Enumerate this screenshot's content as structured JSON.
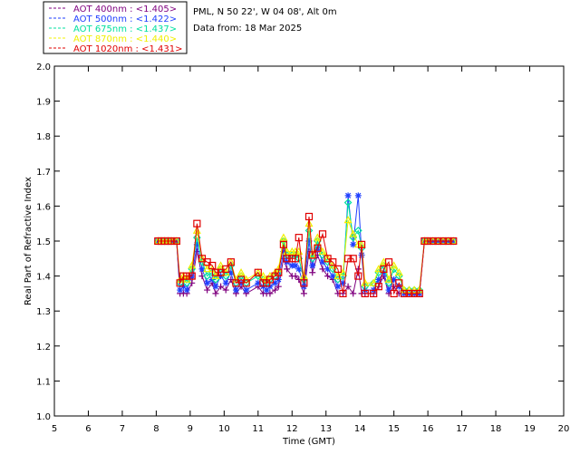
{
  "chart_data": {
    "type": "line",
    "title": "",
    "xlabel": "Time (GMT)",
    "ylabel": "Real Part of Refractive Index",
    "xlim": [
      5,
      20
    ],
    "ylim": [
      1.0,
      2.0
    ],
    "x_ticks": [
      "5",
      "6",
      "7",
      "8",
      "9",
      "10",
      "11",
      "12",
      "13",
      "14",
      "15",
      "16",
      "17",
      "18",
      "19",
      "20"
    ],
    "y_ticks": [
      "1.0",
      "1.1",
      "1.2",
      "1.3",
      "1.4",
      "1.5",
      "1.6",
      "1.7",
      "1.8",
      "1.9",
      "2.0"
    ],
    "info_lines": [
      "PML, N 50 22', W 04 08', Alt 0m",
      "Data from: 18 Mar 2025"
    ],
    "series": [
      {
        "name": "AOT  400nm : <1.405>",
        "color": "#7f007f",
        "marker": "plus",
        "x": [
          8.05,
          8.15,
          8.25,
          8.35,
          8.45,
          8.6,
          8.7,
          8.8,
          8.9,
          9.05,
          9.2,
          9.35,
          9.5,
          9.65,
          9.75,
          9.9,
          10.05,
          10.2,
          10.35,
          10.5,
          10.65,
          11.0,
          11.15,
          11.25,
          11.35,
          11.5,
          11.6,
          11.75,
          11.85,
          12.0,
          12.1,
          12.2,
          12.35,
          12.5,
          12.6,
          12.75,
          12.9,
          13.05,
          13.2,
          13.35,
          13.5,
          13.65,
          13.8,
          13.95,
          14.05,
          14.15,
          14.4,
          14.55,
          14.7,
          14.85,
          15.0,
          15.15,
          15.3,
          15.45,
          15.6,
          15.75,
          15.9,
          16.0,
          16.15,
          16.3,
          16.45,
          16.6,
          16.75
        ],
        "values": [
          1.5,
          1.5,
          1.5,
          1.5,
          1.5,
          1.5,
          1.35,
          1.35,
          1.35,
          1.38,
          1.47,
          1.4,
          1.36,
          1.38,
          1.35,
          1.37,
          1.36,
          1.39,
          1.35,
          1.37,
          1.35,
          1.37,
          1.35,
          1.35,
          1.35,
          1.36,
          1.37,
          1.45,
          1.42,
          1.4,
          1.4,
          1.39,
          1.35,
          1.47,
          1.41,
          1.46,
          1.42,
          1.4,
          1.39,
          1.35,
          1.35,
          1.37,
          1.35,
          1.42,
          1.35,
          1.35,
          1.35,
          1.37,
          1.4,
          1.35,
          1.37,
          1.35,
          1.35,
          1.35,
          1.35,
          1.35,
          1.5,
          1.5,
          1.5,
          1.5,
          1.5,
          1.5,
          1.5
        ]
      },
      {
        "name": "AOT  500nm : <1.422>",
        "color": "#1f3fff",
        "marker": "asterisk",
        "x": [
          8.05,
          8.15,
          8.25,
          8.35,
          8.45,
          8.6,
          8.7,
          8.8,
          8.9,
          9.05,
          9.2,
          9.35,
          9.5,
          9.65,
          9.75,
          9.9,
          10.05,
          10.2,
          10.35,
          10.5,
          10.65,
          11.0,
          11.15,
          11.25,
          11.35,
          11.5,
          11.6,
          11.75,
          11.85,
          12.0,
          12.1,
          12.2,
          12.35,
          12.5,
          12.6,
          12.75,
          12.9,
          13.05,
          13.2,
          13.35,
          13.5,
          13.65,
          13.8,
          13.95,
          14.05,
          14.15,
          14.4,
          14.55,
          14.7,
          14.85,
          15.0,
          15.15,
          15.3,
          15.45,
          15.6,
          15.75,
          15.9,
          16.0,
          16.15,
          16.3,
          16.45,
          16.6,
          16.75
        ],
        "values": [
          1.5,
          1.5,
          1.5,
          1.5,
          1.5,
          1.5,
          1.36,
          1.37,
          1.36,
          1.4,
          1.49,
          1.42,
          1.38,
          1.39,
          1.37,
          1.4,
          1.38,
          1.41,
          1.36,
          1.38,
          1.36,
          1.38,
          1.37,
          1.36,
          1.37,
          1.38,
          1.39,
          1.47,
          1.44,
          1.43,
          1.43,
          1.42,
          1.37,
          1.5,
          1.43,
          1.48,
          1.44,
          1.42,
          1.4,
          1.37,
          1.38,
          1.63,
          1.49,
          1.63,
          1.46,
          1.36,
          1.36,
          1.39,
          1.41,
          1.36,
          1.39,
          1.37,
          1.35,
          1.35,
          1.35,
          1.35,
          1.5,
          1.5,
          1.5,
          1.5,
          1.5,
          1.5,
          1.5
        ]
      },
      {
        "name": "AOT  675nm : <1.437>",
        "color": "#00e0a0",
        "marker": "diamond",
        "x": [
          8.05,
          8.15,
          8.25,
          8.35,
          8.45,
          8.6,
          8.7,
          8.8,
          8.9,
          9.05,
          9.2,
          9.35,
          9.5,
          9.65,
          9.75,
          9.9,
          10.05,
          10.2,
          10.35,
          10.5,
          10.65,
          11.0,
          11.15,
          11.25,
          11.35,
          11.5,
          11.6,
          11.75,
          11.85,
          12.0,
          12.1,
          12.2,
          12.35,
          12.5,
          12.6,
          12.75,
          12.9,
          13.05,
          13.2,
          13.35,
          13.5,
          13.65,
          13.8,
          13.95,
          14.05,
          14.15,
          14.4,
          14.55,
          14.7,
          14.85,
          15.0,
          15.15,
          15.3,
          15.45,
          15.6,
          15.75,
          15.9,
          16.0,
          16.15,
          16.3,
          16.45,
          16.6,
          16.75
        ],
        "values": [
          1.5,
          1.5,
          1.5,
          1.5,
          1.5,
          1.5,
          1.38,
          1.39,
          1.38,
          1.42,
          1.51,
          1.44,
          1.4,
          1.41,
          1.39,
          1.42,
          1.4,
          1.43,
          1.38,
          1.4,
          1.38,
          1.4,
          1.39,
          1.38,
          1.39,
          1.4,
          1.41,
          1.5,
          1.46,
          1.46,
          1.46,
          1.45,
          1.39,
          1.53,
          1.45,
          1.5,
          1.46,
          1.44,
          1.42,
          1.39,
          1.4,
          1.61,
          1.51,
          1.53,
          1.48,
          1.37,
          1.38,
          1.41,
          1.43,
          1.38,
          1.42,
          1.4,
          1.36,
          1.36,
          1.36,
          1.36,
          1.5,
          1.5,
          1.5,
          1.5,
          1.5,
          1.5,
          1.5
        ]
      },
      {
        "name": "AOT  870nm : <1.440>",
        "color": "#f0f000",
        "marker": "triangle",
        "x": [
          8.05,
          8.15,
          8.25,
          8.35,
          8.45,
          8.6,
          8.7,
          8.8,
          8.9,
          9.05,
          9.2,
          9.35,
          9.5,
          9.65,
          9.75,
          9.9,
          10.05,
          10.2,
          10.35,
          10.5,
          10.65,
          11.0,
          11.15,
          11.25,
          11.35,
          11.5,
          11.6,
          11.75,
          11.85,
          12.0,
          12.1,
          12.2,
          12.35,
          12.5,
          12.6,
          12.75,
          12.9,
          13.05,
          13.2,
          13.35,
          13.5,
          13.65,
          13.8,
          13.95,
          14.05,
          14.15,
          14.4,
          14.55,
          14.7,
          14.85,
          15.0,
          15.15,
          15.3,
          15.45,
          15.6,
          15.75,
          15.9,
          16.0,
          16.15,
          16.3,
          16.45,
          16.6,
          16.75
        ],
        "values": [
          1.5,
          1.5,
          1.5,
          1.5,
          1.5,
          1.5,
          1.39,
          1.4,
          1.39,
          1.43,
          1.53,
          1.45,
          1.42,
          1.42,
          1.4,
          1.43,
          1.41,
          1.44,
          1.39,
          1.41,
          1.39,
          1.41,
          1.4,
          1.39,
          1.4,
          1.41,
          1.42,
          1.51,
          1.47,
          1.47,
          1.47,
          1.47,
          1.4,
          1.55,
          1.46,
          1.51,
          1.47,
          1.45,
          1.43,
          1.4,
          1.41,
          1.56,
          1.52,
          1.49,
          1.49,
          1.38,
          1.38,
          1.42,
          1.44,
          1.39,
          1.43,
          1.41,
          1.36,
          1.36,
          1.36,
          1.36,
          1.5,
          1.5,
          1.5,
          1.5,
          1.5,
          1.5,
          1.5
        ]
      },
      {
        "name": "AOT 1020nm : <1.431>",
        "color": "#e00000",
        "marker": "square",
        "x": [
          8.05,
          8.15,
          8.25,
          8.35,
          8.45,
          8.6,
          8.7,
          8.8,
          8.9,
          9.05,
          9.2,
          9.35,
          9.5,
          9.65,
          9.75,
          9.9,
          10.05,
          10.2,
          10.35,
          10.5,
          10.65,
          11.0,
          11.15,
          11.25,
          11.35,
          11.5,
          11.6,
          11.75,
          11.85,
          12.0,
          12.1,
          12.2,
          12.35,
          12.5,
          12.6,
          12.75,
          12.9,
          13.05,
          13.2,
          13.35,
          13.5,
          13.65,
          13.8,
          13.95,
          14.05,
          14.15,
          14.4,
          14.55,
          14.7,
          14.85,
          15.0,
          15.15,
          15.3,
          15.45,
          15.6,
          15.75,
          15.9,
          16.0,
          16.15,
          16.3,
          16.45,
          16.6,
          16.75
        ],
        "values": [
          1.5,
          1.5,
          1.5,
          1.5,
          1.5,
          1.5,
          1.38,
          1.4,
          1.4,
          1.4,
          1.55,
          1.45,
          1.44,
          1.43,
          1.41,
          1.41,
          1.42,
          1.44,
          1.38,
          1.39,
          1.38,
          1.41,
          1.38,
          1.38,
          1.39,
          1.4,
          1.41,
          1.49,
          1.45,
          1.45,
          1.45,
          1.51,
          1.38,
          1.57,
          1.46,
          1.48,
          1.52,
          1.45,
          1.44,
          1.42,
          1.35,
          1.45,
          1.45,
          1.4,
          1.49,
          1.35,
          1.35,
          1.37,
          1.42,
          1.44,
          1.35,
          1.38,
          1.35,
          1.35,
          1.35,
          1.35,
          1.5,
          1.5,
          1.5,
          1.5,
          1.5,
          1.5,
          1.5
        ]
      }
    ]
  }
}
